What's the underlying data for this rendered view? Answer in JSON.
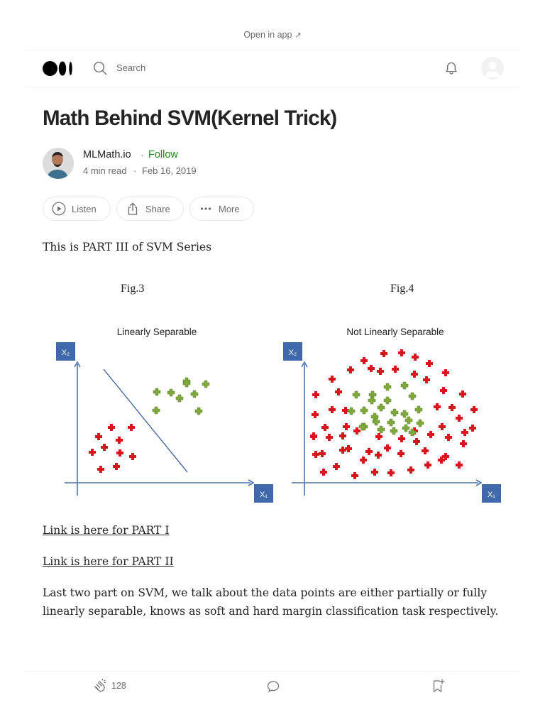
{
  "top_banner": {
    "open_in_app": "Open in app",
    "arrow": "↗"
  },
  "header": {
    "search_placeholder": "Search"
  },
  "article": {
    "title": "Math Behind SVM(Kernel Trick)",
    "author": "MLMath.io",
    "separator": "·",
    "follow_label": "Follow",
    "read_time": "4 min read",
    "date": "Feb 16, 2019"
  },
  "actions": {
    "listen": "Listen",
    "share": "Share",
    "more": "More"
  },
  "content": {
    "intro": "This is PART III of SVM Series",
    "link_part1": "Link is here for PART I",
    "link_part2": "Link is here for PART II",
    "paragraph_line1": "Last two part on SVM, we talk about the data points are either partially or fully",
    "paragraph_line2": "linearly separable, knows as soft and hard margin classification task respectively."
  },
  "figure": {
    "caption_left": "Fig.3",
    "caption_right": "Fig.4",
    "left_title": "Linearly Separable",
    "right_title": "Not Linearly Separable",
    "left_x_axis": "X₁",
    "left_y_axis": "X₂",
    "right_x_axis": "X₁",
    "right_y_axis": "X₂",
    "colors": {
      "axis": "#4a74b4",
      "axis_box": "#3f68ad",
      "red": "#d9141b",
      "green": "#7ea83b"
    }
  },
  "footer": {
    "clap_count": "128"
  }
}
